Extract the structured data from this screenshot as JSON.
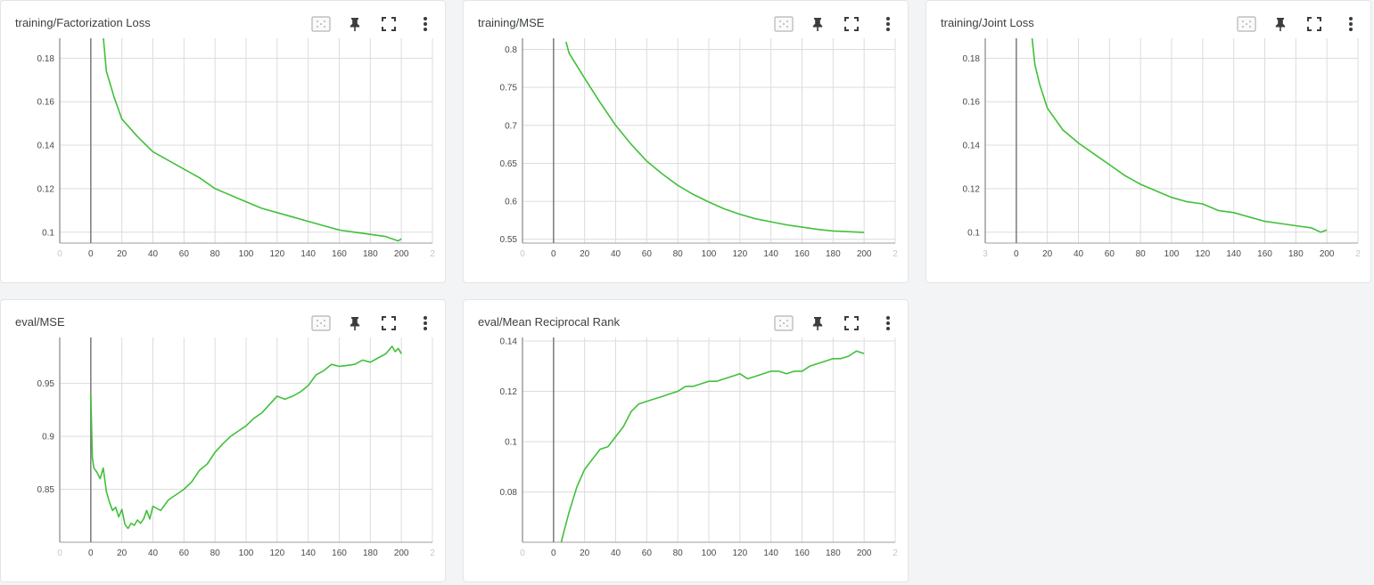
{
  "colors": {
    "series": "#40c03a",
    "grid": "#dcdcdc",
    "axis": "#9e9e9e",
    "zero_line": "#7b7b7b",
    "background": "#f3f4f6"
  },
  "toolbar_icons": [
    "log-scale-toggle-icon",
    "pin-icon",
    "fullscreen-icon",
    "more-vert-icon"
  ],
  "cards": [
    {
      "title": "training/Factorization Loss",
      "chart_data": {
        "type": "line",
        "title": "training/Factorization Loss",
        "xlim": [
          -20,
          220
        ],
        "ylim": [
          0.095,
          0.1875
        ],
        "x_ticks": [
          -20,
          0,
          20,
          40,
          60,
          80,
          100,
          120,
          140,
          160,
          180,
          200,
          220
        ],
        "x_tick_labels": [
          "0",
          "0",
          "20",
          "40",
          "60",
          "80",
          "100",
          "120",
          "140",
          "160",
          "180",
          "200",
          "2"
        ],
        "y_ticks": [
          0.1,
          0.12,
          0.14,
          0.16,
          0.18
        ],
        "y_tick_labels": [
          "0.1",
          "0.12",
          "0.14",
          "0.16",
          "0.18"
        ],
        "grid": true,
        "series": [
          {
            "x": [
              8,
              10,
              15,
              20,
              30,
              40,
              50,
              60,
              70,
              80,
              90,
              100,
              110,
              120,
              130,
              140,
              150,
              160,
              170,
              180,
              190,
              198,
              200
            ],
            "y": [
              0.19,
              0.174,
              0.162,
              0.152,
              0.144,
              0.137,
              0.133,
              0.129,
              0.125,
              0.12,
              0.117,
              0.114,
              0.111,
              0.109,
              0.107,
              0.105,
              0.103,
              0.101,
              0.1,
              0.099,
              0.098,
              0.096,
              0.097
            ]
          }
        ]
      }
    },
    {
      "title": "training/MSE",
      "chart_data": {
        "type": "line",
        "title": "training/MSE",
        "xlim": [
          -20,
          220
        ],
        "ylim": [
          0.545,
          0.81
        ],
        "x_ticks": [
          -20,
          0,
          20,
          40,
          60,
          80,
          100,
          120,
          140,
          160,
          180,
          200,
          220
        ],
        "x_tick_labels": [
          "0",
          "0",
          "20",
          "40",
          "60",
          "80",
          "100",
          "120",
          "140",
          "160",
          "180",
          "200",
          "2"
        ],
        "y_ticks": [
          0.55,
          0.6,
          0.65,
          0.7,
          0.75,
          0.8
        ],
        "y_tick_labels": [
          "0.55",
          "0.6",
          "0.65",
          "0.7",
          "0.75",
          "0.8"
        ],
        "grid": true,
        "series": [
          {
            "x": [
              8,
              10,
              20,
              30,
              40,
              50,
              60,
              70,
              80,
              90,
              100,
              110,
              120,
              130,
              140,
              150,
              160,
              170,
              180,
              190,
              200
            ],
            "y": [
              0.81,
              0.795,
              0.762,
              0.73,
              0.7,
              0.675,
              0.653,
              0.636,
              0.621,
              0.609,
              0.599,
              0.59,
              0.583,
              0.577,
              0.573,
              0.569,
              0.566,
              0.563,
              0.561,
              0.56,
              0.559
            ]
          }
        ]
      }
    },
    {
      "title": "training/Joint Loss",
      "chart_data": {
        "type": "line",
        "title": "training/Joint Loss",
        "xlim": [
          -20,
          220
        ],
        "ylim": [
          0.095,
          0.1875
        ],
        "x_ticks": [
          -20,
          0,
          20,
          40,
          60,
          80,
          100,
          120,
          140,
          160,
          180,
          200,
          220
        ],
        "x_tick_labels": [
          "3",
          "0",
          "20",
          "40",
          "60",
          "80",
          "100",
          "120",
          "140",
          "160",
          "180",
          "200",
          "2"
        ],
        "y_ticks": [
          0.1,
          0.12,
          0.14,
          0.16,
          0.18
        ],
        "y_tick_labels": [
          "0.1",
          "0.12",
          "0.14",
          "0.16",
          "0.18"
        ],
        "grid": true,
        "series": [
          {
            "x": [
              10,
              12,
              15,
              20,
              30,
              40,
              50,
              60,
              70,
              80,
              90,
              100,
              110,
              120,
              130,
              140,
              150,
              160,
              170,
              180,
              190,
              196,
              200
            ],
            "y": [
              0.19,
              0.177,
              0.168,
              0.157,
              0.147,
              0.141,
              0.136,
              0.131,
              0.126,
              0.122,
              0.119,
              0.116,
              0.114,
              0.113,
              0.11,
              0.109,
              0.107,
              0.105,
              0.104,
              0.103,
              0.102,
              0.1,
              0.101
            ]
          }
        ]
      }
    },
    {
      "title": "eval/MSE",
      "chart_data": {
        "type": "line",
        "title": "eval/MSE",
        "xlim": [
          -20,
          220
        ],
        "ylim": [
          0.8,
          0.99
        ],
        "x_ticks": [
          -20,
          0,
          20,
          40,
          60,
          80,
          100,
          120,
          140,
          160,
          180,
          200,
          220
        ],
        "x_tick_labels": [
          "0",
          "0",
          "20",
          "40",
          "60",
          "80",
          "100",
          "120",
          "140",
          "160",
          "180",
          "200",
          "2"
        ],
        "y_ticks": [
          0.85,
          0.9,
          0.95
        ],
        "y_tick_labels": [
          "0.85",
          "0.9",
          "0.95"
        ],
        "grid": true,
        "series": [
          {
            "x": [
              0,
              1,
              2,
              4,
              6,
              8,
              10,
              12,
              14,
              16,
              18,
              20,
              22,
              24,
              26,
              28,
              30,
              32,
              34,
              36,
              38,
              40,
              45,
              50,
              55,
              60,
              65,
              70,
              75,
              80,
              85,
              90,
              95,
              100,
              105,
              110,
              115,
              120,
              125,
              130,
              135,
              140,
              145,
              150,
              155,
              160,
              165,
              170,
              175,
              180,
              185,
              190,
              194,
              196,
              198,
              200
            ],
            "y": [
              0.94,
              0.88,
              0.87,
              0.866,
              0.86,
              0.87,
              0.848,
              0.838,
              0.83,
              0.833,
              0.824,
              0.831,
              0.817,
              0.813,
              0.818,
              0.816,
              0.821,
              0.818,
              0.822,
              0.83,
              0.822,
              0.834,
              0.83,
              0.84,
              0.845,
              0.85,
              0.857,
              0.868,
              0.874,
              0.885,
              0.893,
              0.9,
              0.905,
              0.91,
              0.917,
              0.922,
              0.93,
              0.938,
              0.935,
              0.938,
              0.942,
              0.948,
              0.958,
              0.962,
              0.968,
              0.966,
              0.967,
              0.968,
              0.972,
              0.97,
              0.974,
              0.978,
              0.985,
              0.98,
              0.983,
              0.978
            ]
          }
        ]
      }
    },
    {
      "title": "eval/Mean Reciprocal Rank",
      "chart_data": {
        "type": "line",
        "title": "eval/Mean Reciprocal Rank",
        "xlim": [
          -20,
          220
        ],
        "ylim": [
          0.06,
          0.14
        ],
        "x_ticks": [
          -20,
          0,
          20,
          40,
          60,
          80,
          100,
          120,
          140,
          160,
          180,
          200,
          220
        ],
        "x_tick_labels": [
          "0",
          "0",
          "20",
          "40",
          "60",
          "80",
          "100",
          "120",
          "140",
          "160",
          "180",
          "200",
          "2"
        ],
        "y_ticks": [
          0.08,
          0.1,
          0.12,
          0.14
        ],
        "y_tick_labels": [
          "0.08",
          "0.1",
          "0.12",
          "0.14"
        ],
        "grid": true,
        "series": [
          {
            "x": [
              5,
              7,
              10,
              15,
              20,
              25,
              30,
              35,
              40,
              45,
              50,
              55,
              60,
              65,
              70,
              75,
              80,
              85,
              90,
              95,
              100,
              105,
              110,
              115,
              120,
              125,
              130,
              135,
              140,
              145,
              150,
              155,
              160,
              165,
              170,
              175,
              180,
              185,
              190,
              195,
              200
            ],
            "y": [
              0.06,
              0.065,
              0.072,
              0.082,
              0.089,
              0.093,
              0.097,
              0.098,
              0.102,
              0.106,
              0.112,
              0.115,
              0.116,
              0.117,
              0.118,
              0.119,
              0.12,
              0.122,
              0.122,
              0.123,
              0.124,
              0.124,
              0.125,
              0.126,
              0.127,
              0.125,
              0.126,
              0.127,
              0.128,
              0.128,
              0.127,
              0.128,
              0.128,
              0.13,
              0.131,
              0.132,
              0.133,
              0.133,
              0.134,
              0.136,
              0.135
            ]
          }
        ]
      }
    }
  ]
}
